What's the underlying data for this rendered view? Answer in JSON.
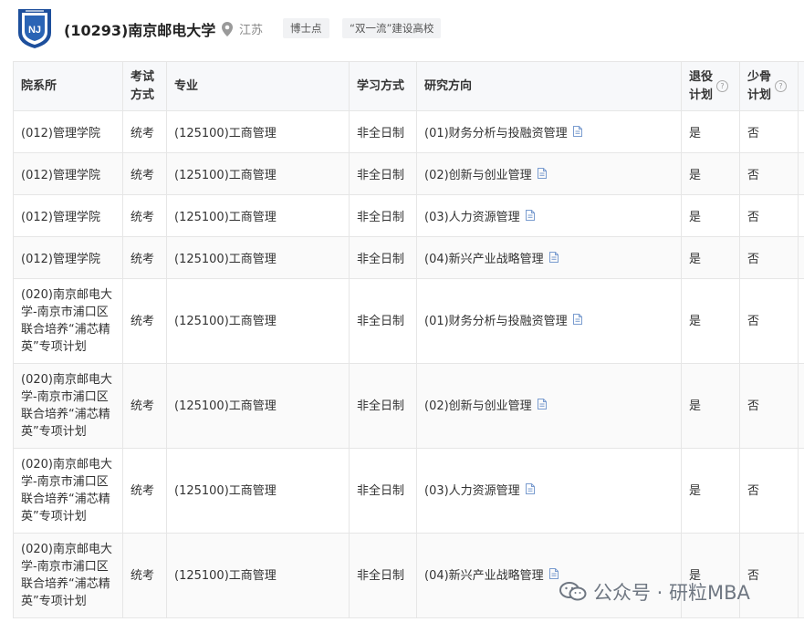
{
  "header": {
    "school_name": "(10293)南京邮电大学",
    "location": "江苏",
    "tags": [
      "博士点",
      "“双一流”建设高校"
    ],
    "icons": {
      "logo": "university-seal-icon",
      "location": "location-pin-icon"
    }
  },
  "table": {
    "headers": {
      "dept": "院系所",
      "exam_line1": "考试",
      "exam_line2": "方式",
      "major": "专业",
      "study": "学习方式",
      "direction": "研究方向",
      "retired_line1": "退役",
      "retired_line2": "计划",
      "minority_line1": "少骨",
      "minority_line2": "计划"
    },
    "rows": [
      {
        "dept": "(012)管理学院",
        "exam": "统考",
        "major": "(125100)工商管理",
        "study": "非全日制",
        "direction": "(01)财务分析与投融资管理",
        "retired": "是",
        "minority": "否"
      },
      {
        "dept": "(012)管理学院",
        "exam": "统考",
        "major": "(125100)工商管理",
        "study": "非全日制",
        "direction": "(02)创新与创业管理",
        "retired": "是",
        "minority": "否"
      },
      {
        "dept": "(012)管理学院",
        "exam": "统考",
        "major": "(125100)工商管理",
        "study": "非全日制",
        "direction": "(03)人力资源管理",
        "retired": "是",
        "minority": "否"
      },
      {
        "dept": "(012)管理学院",
        "exam": "统考",
        "major": "(125100)工商管理",
        "study": "非全日制",
        "direction": "(04)新兴产业战略管理",
        "retired": "是",
        "minority": "否"
      },
      {
        "dept": "(020)南京邮电大学-南京市浦口区联合培养“浦芯精英”专项计划",
        "exam": "统考",
        "major": "(125100)工商管理",
        "study": "非全日制",
        "direction": "(01)财务分析与投融资管理",
        "retired": "是",
        "minority": "否"
      },
      {
        "dept": "(020)南京邮电大学-南京市浦口区联合培养“浦芯精英”专项计划",
        "exam": "统考",
        "major": "(125100)工商管理",
        "study": "非全日制",
        "direction": "(02)创新与创业管理",
        "retired": "是",
        "minority": "否"
      },
      {
        "dept": "(020)南京邮电大学-南京市浦口区联合培养“浦芯精英”专项计划",
        "exam": "统考",
        "major": "(125100)工商管理",
        "study": "非全日制",
        "direction": "(03)人力资源管理",
        "retired": "是",
        "minority": "否"
      },
      {
        "dept": "(020)南京邮电大学-南京市浦口区联合培养“浦芯精英”专项计划",
        "exam": "统考",
        "major": "(125100)工商管理",
        "study": "非全日制",
        "direction": "(04)新兴产业战略管理",
        "retired": "是",
        "minority": "否"
      }
    ]
  },
  "watermark": {
    "text": "公众号 · 研粒MBA",
    "icon": "wechat-icon"
  },
  "colors": {
    "header_bg": "#f7f8fa",
    "border": "#e6e6e6",
    "tag_bg": "#f1f2f4",
    "logo_blue": "#1d4f9c",
    "doc_icon": "#7a9ccf"
  }
}
